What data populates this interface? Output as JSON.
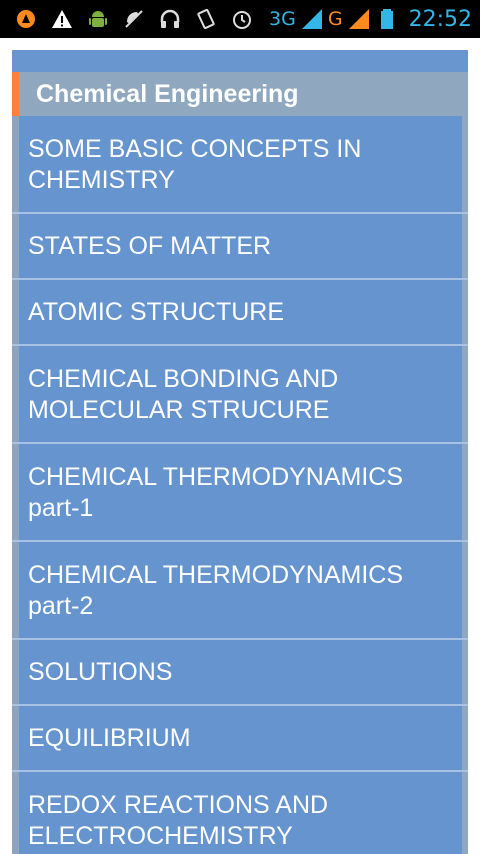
{
  "status_bar": {
    "left_icons": [
      "avast-icon",
      "warning-icon",
      "android-debug-icon",
      "phone-silent-icon",
      "headphones-icon",
      "vibrate-icon",
      "alarm-icon"
    ],
    "network_3g_label": "3G",
    "network_g_label": "G",
    "time": "22:52",
    "colors": {
      "accent": "#33b5e5",
      "secondary_signal": "#ff8a1d"
    }
  },
  "category": {
    "title": "Chemical Engineering",
    "accent_color": "#ff7f3b"
  },
  "items": [
    {
      "label": "SOME BASIC CONCEPTS IN\nCHEMISTRY"
    },
    {
      "label": "STATES OF MATTER"
    },
    {
      "label": "ATOMIC STRUCTURE"
    },
    {
      "label": "CHEMICAL BONDING AND\nMOLECULAR STRUCURE"
    },
    {
      "label": "CHEMICAL THERMODYNAMICS\npart-1"
    },
    {
      "label": "CHEMICAL THERMODYNAMICS\npart-2"
    },
    {
      "label": "SOLUTIONS"
    },
    {
      "label": "EQUILIBRIUM"
    },
    {
      "label": "REDOX REACTIONS AND\nELECTROCHEMISTRY"
    }
  ],
  "colors": {
    "panel_background": "#6a96cf",
    "header_background": "#8fa7bf",
    "divider": "#a9c2e4",
    "text": "#ffffff"
  }
}
